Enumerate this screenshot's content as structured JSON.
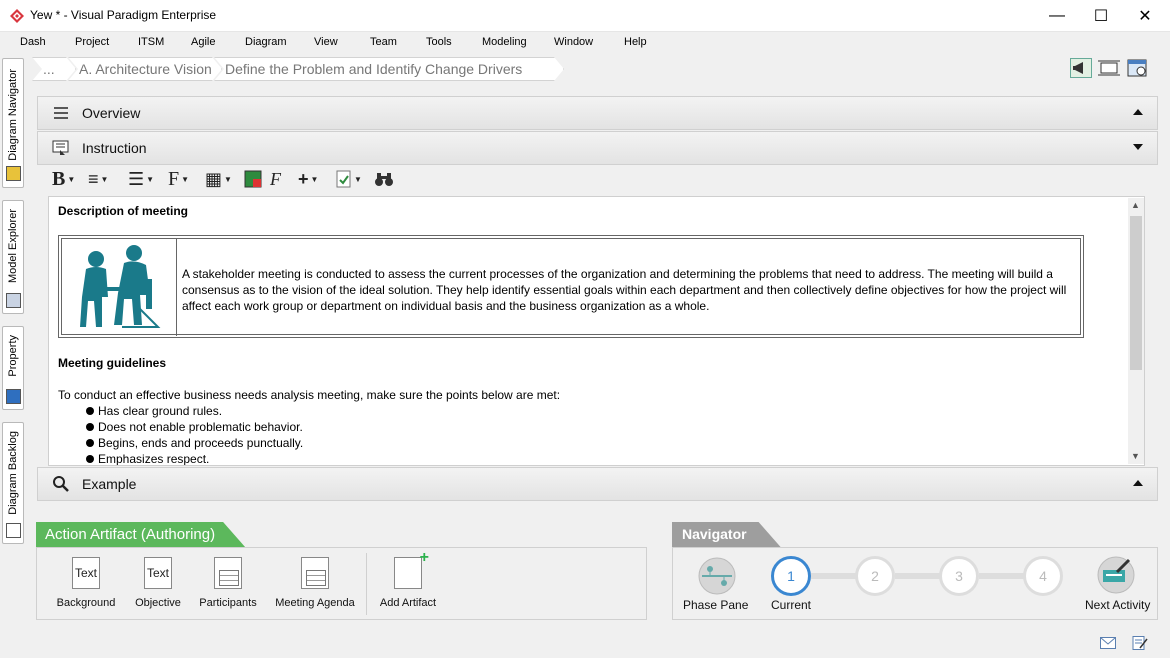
{
  "window": {
    "title": "Yew * - Visual Paradigm Enterprise",
    "controls": [
      "minimize-icon",
      "maximize-icon",
      "close-icon"
    ]
  },
  "menu": [
    "Dash",
    "Project",
    "ITSM",
    "Agile",
    "Diagram",
    "View",
    "Team",
    "Tools",
    "Modeling",
    "Window",
    "Help"
  ],
  "left_dock": {
    "tabs": [
      "Diagram Navigator",
      "Model Explorer",
      "Property",
      "Diagram Backlog"
    ]
  },
  "breadcrumb": [
    "...",
    "A. Architecture Vision",
    "Define the Problem and Identify Change Drivers"
  ],
  "panels": {
    "overview": "Overview",
    "instruction": "Instruction",
    "example": "Example"
  },
  "editor": {
    "description_heading": "Description of meeting",
    "description_text": "A stakeholder meeting is conducted to assess the current processes of the organization and determining the problems that need to address. The meeting will build a consensus as to the vision of the ideal solution. They help identify essential goals within each department and then collectively define objectives for how the project will affect each work group or department on individual basis and the business organization as a whole.",
    "guidelines_heading": "Meeting guidelines",
    "guidelines_intro": "To conduct an effective business needs analysis meeting, make sure the points below are met:",
    "guidelines": [
      "Has clear ground rules.",
      "Does not enable problematic behavior.",
      "Begins, ends and proceeds punctually.",
      "Emphasizes respect."
    ]
  },
  "action_artifact": {
    "title": "Action Artifact (Authoring)",
    "artifacts": [
      {
        "label": "Background",
        "icon_text": "Text"
      },
      {
        "label": "Objective",
        "icon_text": "Text"
      },
      {
        "label": "Participants",
        "icon_text": ""
      },
      {
        "label": "Meeting Agenda",
        "icon_text": ""
      }
    ],
    "add_label": "Add Artifact"
  },
  "navigator": {
    "title": "Navigator",
    "phase_pane": "Phase Pane",
    "current": "Current",
    "steps": [
      "1",
      "2",
      "3",
      "4"
    ],
    "current_step": 1,
    "next_activity": "Next Activity"
  },
  "colors": {
    "artifact_green": "#5cb85c",
    "navigator_gray": "#9e9e9e",
    "current_blue": "#3a87d1",
    "figure_teal": "#1a7a8a"
  }
}
